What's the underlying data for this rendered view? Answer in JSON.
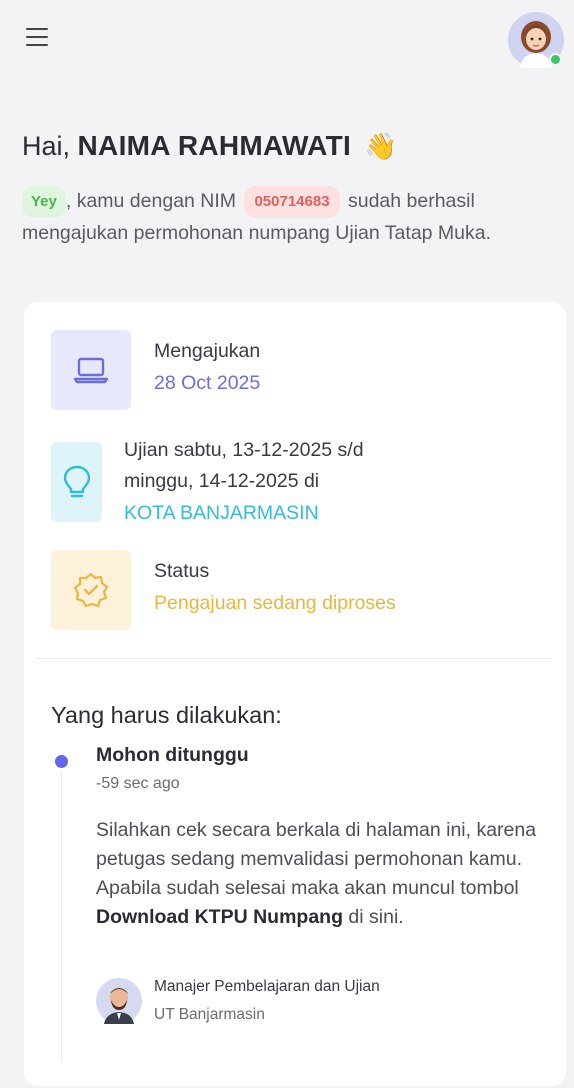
{
  "header": {
    "menu_icon": "hamburger-menu-icon",
    "avatar_icon": "user-avatar-icon"
  },
  "greeting": {
    "prefix": "Hai,",
    "name": "NAIMA RAHMAWATI",
    "emoji": "👋"
  },
  "intro": {
    "badge_yey": "Yey",
    "text1": ", kamu dengan NIM",
    "nim": "050714683",
    "text2": "sudah berhasil mengajukan permohonan numpang Ujian Tatap Muka."
  },
  "info": {
    "submitted": {
      "icon": "laptop-icon",
      "label": "Mengajukan",
      "value": "28 Oct 2025",
      "color": "#6c6ed6",
      "tile_color": "#e8e8fb"
    },
    "exam": {
      "icon": "lightbulb-icon",
      "line1": "Ujian sabtu, 13-12-2025 s/d",
      "line2": "minggu, 14-12-2025 di",
      "location": "KOTA BANJARMASIN",
      "color": "#33bcd8",
      "tile_color": "#dff4f8"
    },
    "status": {
      "icon": "badge-check-icon",
      "label": "Status",
      "value": "Pengajuan sedang diproses",
      "color": "#e7b840",
      "tile_color": "#fdf1d9"
    }
  },
  "todo": {
    "title": "Yang harus dilakukan:",
    "item_title": "Mohon ditunggu",
    "item_time": "-59 sec ago",
    "body_text": "Silahkan cek secara berkala di halaman ini, karena petugas sedang memvalidasi permohonan kamu. Apabila sudah selesai maka akan muncul tombol",
    "body_bold": "Download KTPU Numpang",
    "body_end": "di sini.",
    "officer_title": "Manajer Pembelajaran dan Ujian",
    "officer_unit": "UT Banjarmasin"
  }
}
